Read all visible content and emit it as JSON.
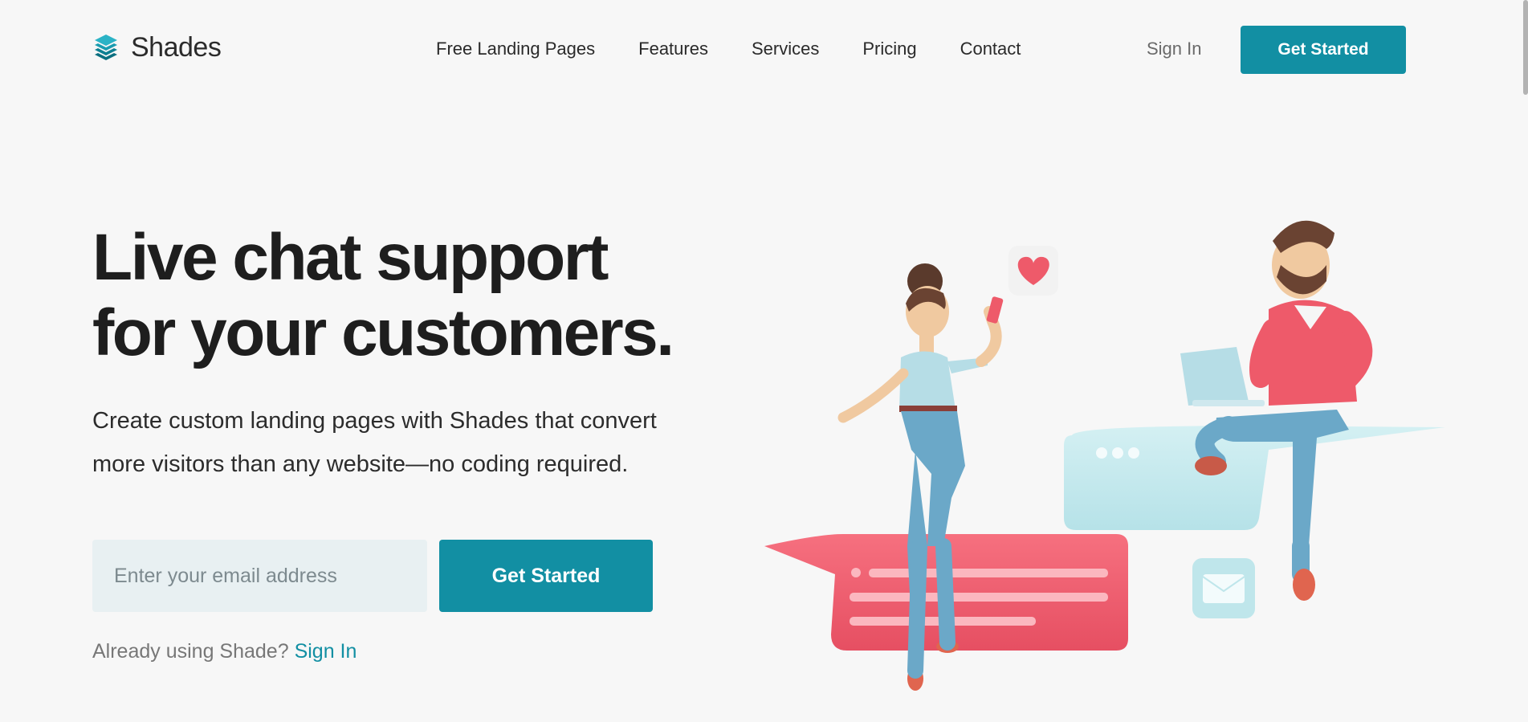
{
  "brand": {
    "name": "Shades",
    "accent_color": "#128fa3",
    "logo_icon": "stacked-layers-icon"
  },
  "nav": {
    "items": [
      {
        "label": "Free Landing Pages"
      },
      {
        "label": "Features"
      },
      {
        "label": "Services"
      },
      {
        "label": "Pricing"
      },
      {
        "label": "Contact"
      }
    ],
    "sign_in_label": "Sign In",
    "cta_label": "Get Started"
  },
  "hero": {
    "headline_line1": "Live chat support",
    "headline_line2": "for your customers.",
    "subtext_line1": "Create custom landing pages with Shades that convert",
    "subtext_line2": "more visitors than any website—no coding required.",
    "email_placeholder": "Enter your email address",
    "cta_label": "Get Started",
    "already_text": "Already using Shade?",
    "sign_in_link": "Sign In"
  },
  "illustration": {
    "description_icon": "chat-support-illustration-icon"
  }
}
